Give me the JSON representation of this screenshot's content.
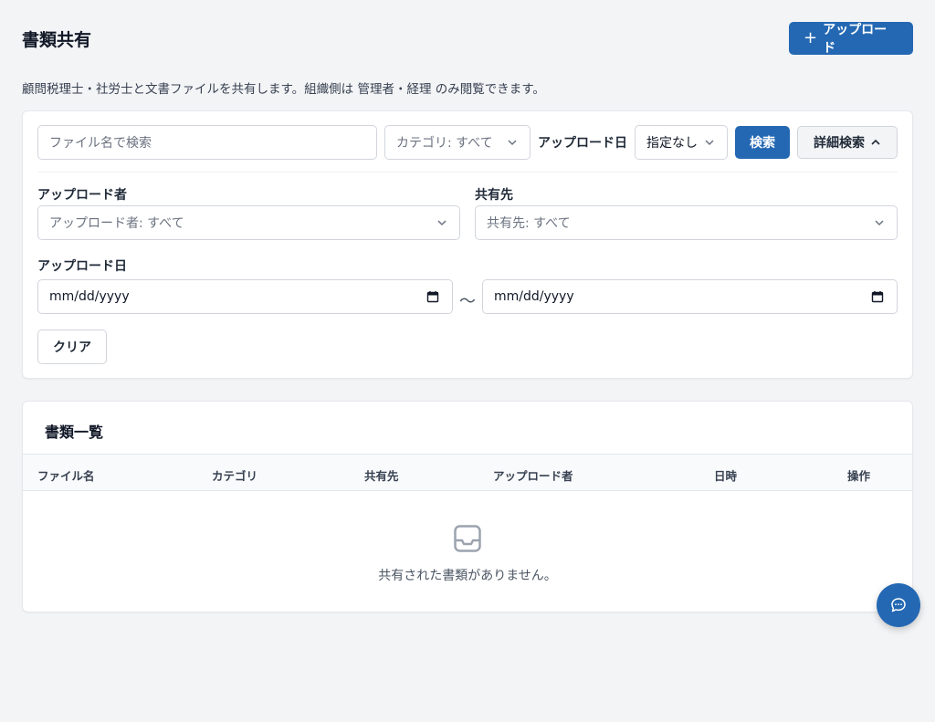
{
  "header": {
    "title": "書類共有",
    "upload_plus": "+",
    "upload_label": "アップロード"
  },
  "description": "顧問税理士・社労士と文書ファイルを共有します。組織側は 管理者・経理 のみ閲覧できます。",
  "filters": {
    "search_placeholder": "ファイル名で検索",
    "category_value": "カテゴリ: すべて",
    "upload_date_label": "アップロード日",
    "upload_date_value": "指定なし",
    "search_button": "検索",
    "advanced_button": "詳細検索",
    "uploader_label": "アップロード者",
    "uploader_value": "アップロード者: すべて",
    "share_label": "共有先",
    "share_value": "共有先: すべて",
    "date_range_label": "アップロード日",
    "date_from": "mm/dd/yyyy",
    "date_tilde": "〜",
    "date_to": "mm/dd/yyyy",
    "clear_button": "クリア"
  },
  "list": {
    "title": "書類一覧",
    "columns": [
      "ファイル名",
      "カテゴリ",
      "共有先",
      "アップロード者",
      "日時",
      "操作"
    ],
    "empty_text": "共有された書類がありません。"
  },
  "colors": {
    "primary": "#2468b3",
    "background": "#f3f4f6"
  },
  "icons": {
    "select": "chevron-down-icon",
    "advanced": "chevron-up-icon",
    "date": "calendar-icon",
    "empty": "inbox-icon",
    "fab": "chat-bubble-icon"
  }
}
